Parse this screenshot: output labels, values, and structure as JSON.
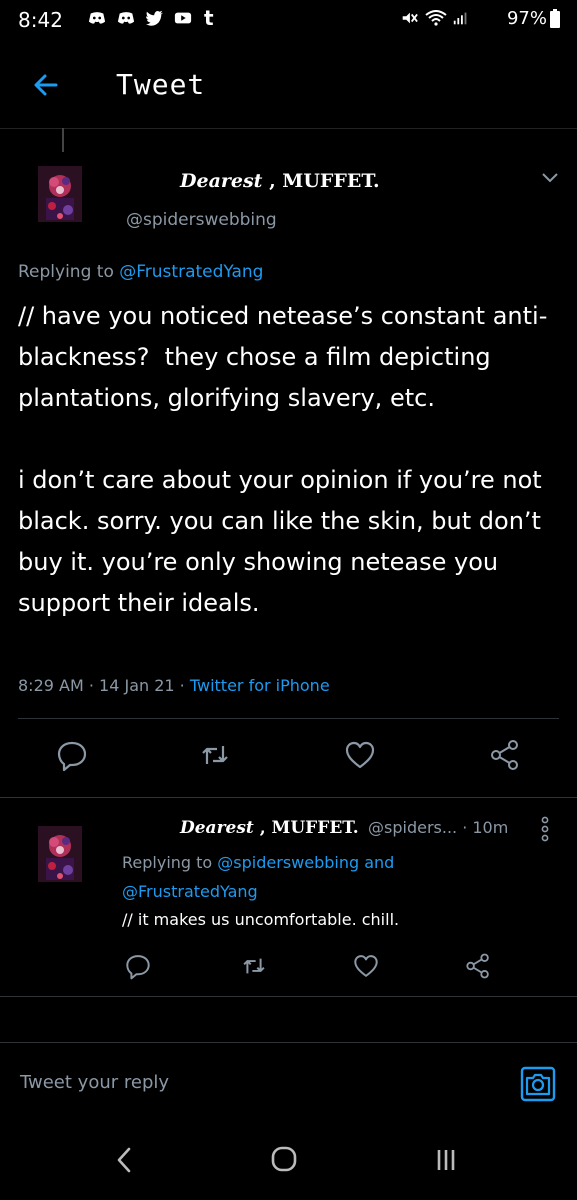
{
  "status_bar": {
    "time": "8:42",
    "battery": "97%",
    "icons": [
      "discord-icon",
      "discord-icon",
      "twitter-icon",
      "youtube-icon",
      "tumblr-icon",
      "mute-icon",
      "wifi-icon",
      "signal-icon",
      "battery-icon"
    ]
  },
  "header": {
    "title": "Tweet"
  },
  "main_tweet": {
    "name_script": "Dearest",
    "name_rest": " , MUFFET.",
    "handle": "@spiderswebbing",
    "replying_prefix": "Replying to ",
    "replying_to": "@FrustratedYang",
    "text": "// have you noticed netease’s constant anti-blackness?  they chose a film depicting plantations, glorifying slavery, etc.\n\ni don’t care about your opinion if you’re not black. sorry. you can like the skin, but don’t buy it. you’re only showing netease you support their ideals.",
    "time": "8:29 AM",
    "date": "14 Jan 21",
    "source": "Twitter for iPhone",
    "sep": " · "
  },
  "reply_tweet": {
    "name_script": "Dearest",
    "name_rest": " , MUFFET.",
    "handle_time": "@spiders... · 10m",
    "replying_prefix": "Replying to ",
    "replying_to_1": "@spiderswebbing",
    "replying_and": " and",
    "replying_to_2": "@FrustratedYang",
    "text": "// it makes us uncomfortable. chill."
  },
  "compose": {
    "placeholder": "Tweet your reply"
  },
  "colors": {
    "background": "#000000",
    "accent": "#1d9bf0",
    "secondary_text": "#8b98a5",
    "divider": "#2f3336"
  }
}
